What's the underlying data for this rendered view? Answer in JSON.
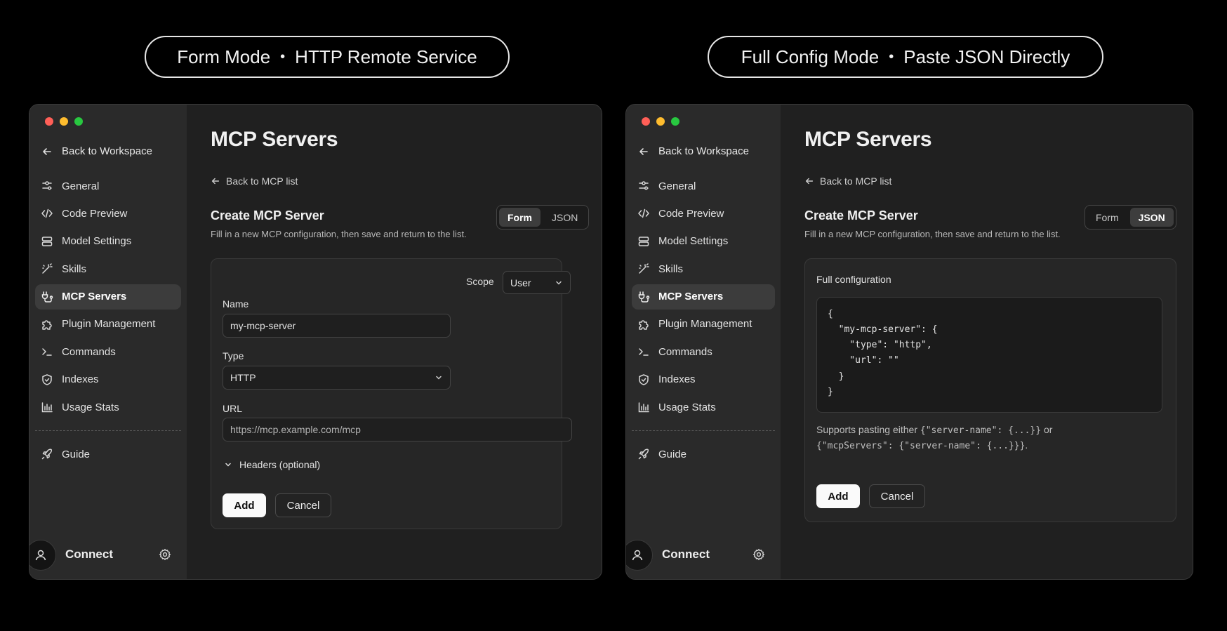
{
  "captions": {
    "left": {
      "mode": "Form Mode",
      "sep": "•",
      "desc": "HTTP Remote Service"
    },
    "right": {
      "mode": "Full Config Mode",
      "sep": "•",
      "desc": "Paste JSON Directly"
    }
  },
  "sidebar": {
    "back_label": "Back to Workspace",
    "items": [
      {
        "label": "General",
        "icon": "sliders-icon"
      },
      {
        "label": "Code Preview",
        "icon": "code-icon"
      },
      {
        "label": "Model Settings",
        "icon": "server-icon"
      },
      {
        "label": "Skills",
        "icon": "magic-wand-icon"
      },
      {
        "label": "MCP Servers",
        "icon": "plug-icon",
        "active": true
      },
      {
        "label": "Plugin Management",
        "icon": "puzzle-icon"
      },
      {
        "label": "Commands",
        "icon": "terminal-icon"
      },
      {
        "label": "Indexes",
        "icon": "shield-icon"
      },
      {
        "label": "Usage Stats",
        "icon": "bar-chart-icon"
      }
    ],
    "guide_label": "Guide",
    "connect_label": "Connect"
  },
  "main": {
    "title": "MCP Servers",
    "back_list": "Back to MCP list",
    "section_title": "Create MCP Server",
    "section_desc": "Fill in a new MCP configuration, then save and return to the list.",
    "toggle": {
      "form": "Form",
      "json": "JSON"
    }
  },
  "form": {
    "scope_label": "Scope",
    "scope_value": "User",
    "name_label": "Name",
    "name_value": "my-mcp-server",
    "type_label": "Type",
    "type_value": "HTTP",
    "url_label": "URL",
    "url_placeholder": "https://mcp.example.com/mcp",
    "headers_label": "Headers (optional)",
    "add": "Add",
    "cancel": "Cancel"
  },
  "json_mode": {
    "config_label": "Full configuration",
    "code_lines": [
      "{",
      "  \"my-mcp-server\": {",
      "    \"type\": \"http\",",
      "    \"url\": \"\"",
      "  }",
      "}"
    ],
    "note_prefix": "Supports pasting either ",
    "note_code1": "{\"server-name\": {...}}",
    "note_or": " or",
    "note_code2": "{\"mcpServers\": {\"server-name\": {...}}}",
    "note_end": ".",
    "add": "Add",
    "cancel": "Cancel"
  },
  "colors": {
    "red": "#ff5f57",
    "yellow": "#febc2e",
    "green": "#28c840",
    "active_bg": "#3c3c3c"
  }
}
